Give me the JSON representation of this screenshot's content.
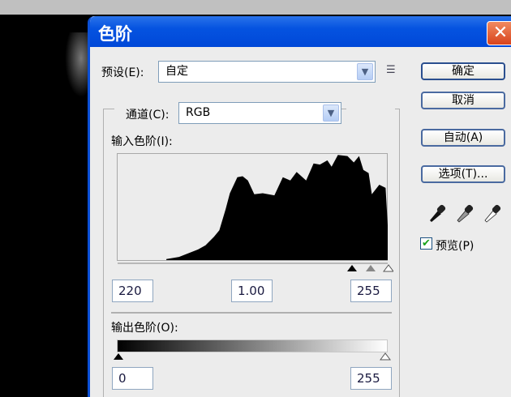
{
  "window": {
    "title": "色阶",
    "close_glyph": "✕"
  },
  "preset": {
    "label": "预设(E):",
    "value": "自定"
  },
  "channel": {
    "label": "通道(C):",
    "value": "RGB"
  },
  "input_levels": {
    "label": "输入色阶(I):",
    "black": "220",
    "gamma": "1.00",
    "white": "255"
  },
  "output_levels": {
    "label": "输出色阶(O):",
    "black": "0",
    "white": "255"
  },
  "buttons": {
    "ok": "确定",
    "cancel": "取消",
    "auto": "自动(A)",
    "options": "选项(T)..."
  },
  "preview": {
    "label": "预览(P)",
    "checked": true
  },
  "histogram": {
    "levels": [
      46,
      58,
      76,
      83,
      91,
      96,
      102,
      106,
      113,
      118,
      123,
      129,
      137,
      148,
      156,
      163,
      169,
      178,
      185,
      191,
      198,
      202,
      208,
      217,
      223,
      228,
      232,
      237,
      240,
      247,
      253,
      255
    ],
    "heights": [
      0.01,
      0.03,
      0.1,
      0.14,
      0.22,
      0.28,
      0.48,
      0.63,
      0.78,
      0.79,
      0.75,
      0.62,
      0.63,
      0.61,
      0.78,
      0.75,
      0.83,
      0.75,
      0.91,
      0.9,
      0.94,
      0.88,
      0.99,
      0.98,
      0.92,
      0.98,
      0.85,
      0.82,
      0.62,
      0.71,
      0.68,
      0.33
    ]
  },
  "colors": {
    "titlebar": "#0553e0",
    "dialog_bg": "#ececec",
    "check": "#1aa31a"
  }
}
